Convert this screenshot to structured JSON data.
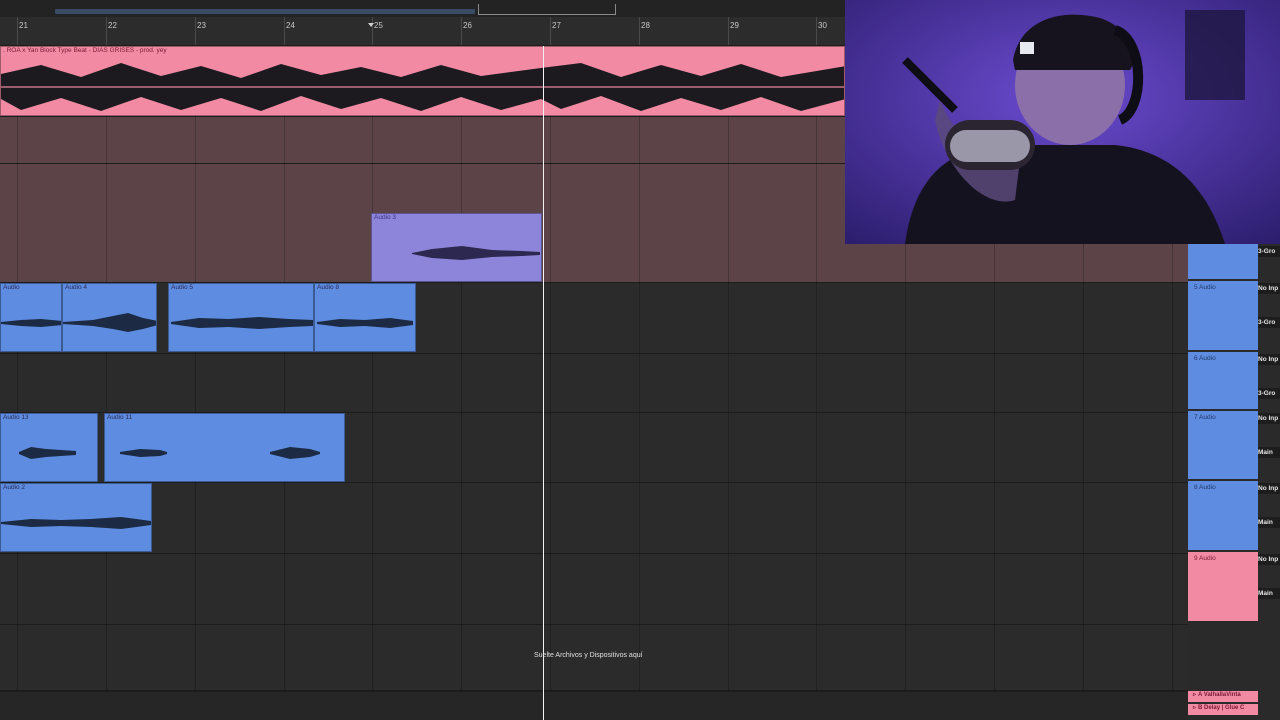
{
  "ruler": {
    "bars": [
      "21",
      "22",
      "23",
      "24",
      "25",
      "26",
      "27",
      "28",
      "29",
      "30"
    ]
  },
  "tracks": {
    "beat_clip_name": ". ROA x Yan Block Type Beat - DIAS GRISES - prod. yey",
    "clips": [
      {
        "name": "Audio 3"
      },
      {
        "name": "Audio"
      },
      {
        "name": "Audio 4"
      },
      {
        "name": "Audio 5"
      },
      {
        "name": "Audio 8"
      },
      {
        "name": "Audio 13"
      },
      {
        "name": "Audio 11"
      },
      {
        "name": "Audio 2"
      }
    ]
  },
  "drop_zone_text": "Suelte Archivos y Dispositivos aquí",
  "mixer": {
    "tracks": [
      {
        "name": "5 Audio",
        "input": "No Inp",
        "output": "3-Gro"
      },
      {
        "name": "6 Audio",
        "input": "No Inp",
        "output": "3-Gro"
      },
      {
        "name": "7 Audio",
        "input": "No Inp",
        "output": "Main"
      },
      {
        "name": "8 Audio",
        "input": "No Inp",
        "output": "Main"
      },
      {
        "name": "9 Audio",
        "input": "No Inp",
        "output": "Main"
      }
    ],
    "top_output": "3-Gro",
    "returns": [
      "A ValhallaVinta",
      "B Delay | Glue C"
    ]
  },
  "colors": {
    "audio_clip": "#5d8ce0",
    "beat_clip": "#f28aa4",
    "selected_clip": "#8d85da",
    "playhead": "#f2f2f2"
  }
}
